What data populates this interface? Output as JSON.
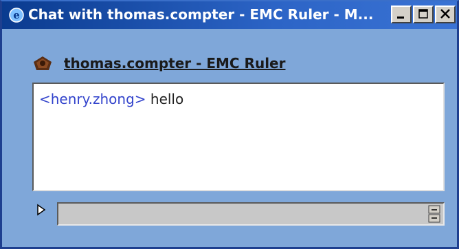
{
  "window": {
    "title": "Chat with thomas.compter - EMC Ruler - M...",
    "buttons": {
      "minimize": "minimize",
      "maximize": "maximize",
      "close": "close"
    }
  },
  "contact": {
    "name": "thomas.compter - EMC Ruler",
    "icon": "buddy-icon"
  },
  "chat": {
    "messages": [
      {
        "user": "<henry.zhong>",
        "text": "hello"
      }
    ]
  },
  "input": {
    "value": ""
  },
  "colors": {
    "titlebar": "#0a3b8f",
    "window_bg": "#7fa7d9",
    "username": "#3344cc"
  }
}
